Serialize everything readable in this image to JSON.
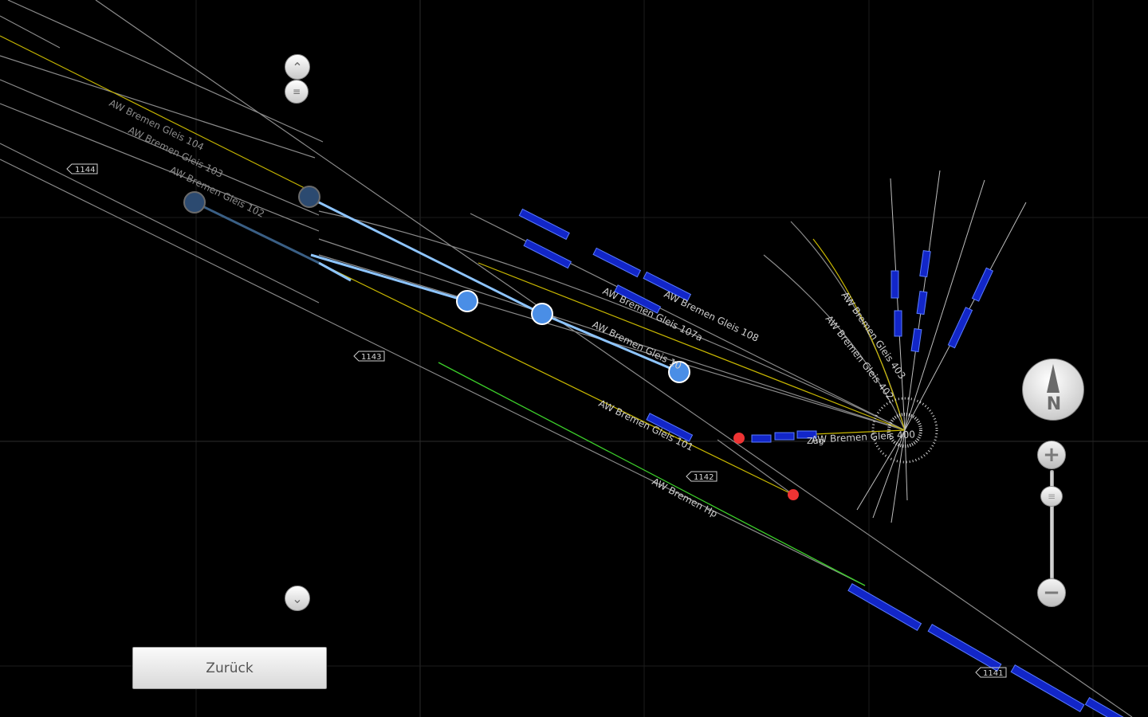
{
  "map": {
    "tracks": {
      "gleis_104": "AW Bremen Gleis 104",
      "gleis_103": "AW Bremen Gleis 103",
      "gleis_102": "AW Bremen Gleis 102",
      "gleis_108": "AW Bremen Gleis 108",
      "gleis_107a": "AW Bremen Gleis 107a",
      "gleis_10x": "AW Bremen Gleis 10",
      "gleis_101": "AW Bremen Gleis 101",
      "gleis_403": "AW Bremen Gleis 403",
      "gleis_402": "AW Bremen Gleis 402",
      "gleis_400": "AW Bremen Gleis 400",
      "hp": "AW Bremen Hp",
      "zug": "Zug"
    },
    "markers": {
      "m1144": "1144",
      "m1143": "1143",
      "m1142": "1142",
      "m1141": "1141"
    },
    "colors": {
      "track": "#9a9a9a",
      "yellow_track": "#c9b800",
      "green_track": "#3ccf2a",
      "route": "#8ec5ff",
      "node": "#4a8ee6",
      "node_dim": "#2c4a70",
      "train": "#1226c8",
      "signal_red": "#ee3333"
    }
  },
  "controls": {
    "scroll_up_icon": "chevron-up",
    "scroll_handle_icon": "grip",
    "scroll_down_icon": "chevron-down",
    "zoom_in": "+",
    "zoom_out": "−",
    "zoom_handle": "≡",
    "compass_label": "N",
    "back_button": "Zurück"
  }
}
